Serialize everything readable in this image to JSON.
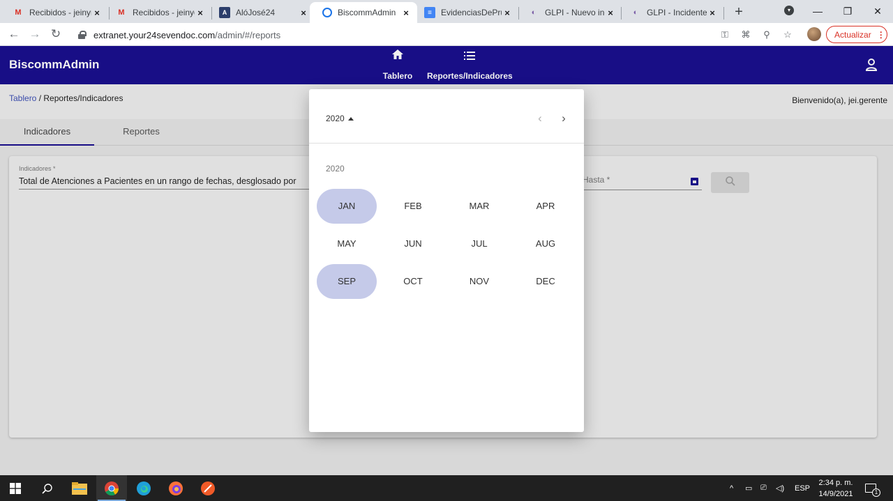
{
  "browser": {
    "tabs": [
      {
        "title": "Recibidos - jeinym",
        "icon": "gmail-icon"
      },
      {
        "title": "Recibidos - jeinyg",
        "icon": "gmail-icon"
      },
      {
        "title": "AlóJosé24",
        "icon": "alojose-icon"
      },
      {
        "title": "BiscommAdmin",
        "icon": "biscomm-icon"
      },
      {
        "title": "EvidenciasDePrue",
        "icon": "docs-icon"
      },
      {
        "title": "GLPI - Nuevo inci",
        "icon": "glpi-icon"
      },
      {
        "title": "GLPI - Incidentes",
        "icon": "glpi-icon"
      }
    ],
    "url_host": "extranet.your24sevendoc.com",
    "url_path": "/admin/#/reports",
    "update_label": "Actualizar"
  },
  "app": {
    "title": "BiscommAdmin",
    "nav": [
      {
        "label": "Tablero",
        "icon": "home-icon"
      },
      {
        "label": "Reportes/Indicadores",
        "icon": "list-icon"
      }
    ],
    "breadcrumb": {
      "link": "Tablero",
      "separator": " / ",
      "current": "Reportes/Indicadores"
    },
    "welcome": "Bienvenido(a), jei.gerente",
    "tabs": [
      "Indicadores",
      "Reportes"
    ],
    "active_tab": "Indicadores",
    "form": {
      "indicator_label": "Indicadores *",
      "indicator_value": "Total de Atenciones a Pacientes en un rango de fechas, desglosado por",
      "hasta_label": "Hasta *"
    }
  },
  "picker": {
    "header_year": "2020",
    "period_label": "2020",
    "months": [
      "JAN",
      "FEB",
      "MAR",
      "APR",
      "MAY",
      "JUN",
      "JUL",
      "AUG",
      "SEP",
      "OCT",
      "NOV",
      "DEC"
    ],
    "highlighted": [
      "JAN",
      "SEP"
    ]
  },
  "taskbar": {
    "lang": "ESP",
    "time": "2:34 p. m.",
    "date": "14/9/2021",
    "notifications": "1"
  },
  "colors": {
    "appbar": "#1a0f8f",
    "selected_month": "#c5cae9",
    "link": "#3f51b5",
    "update": "#d93025"
  }
}
